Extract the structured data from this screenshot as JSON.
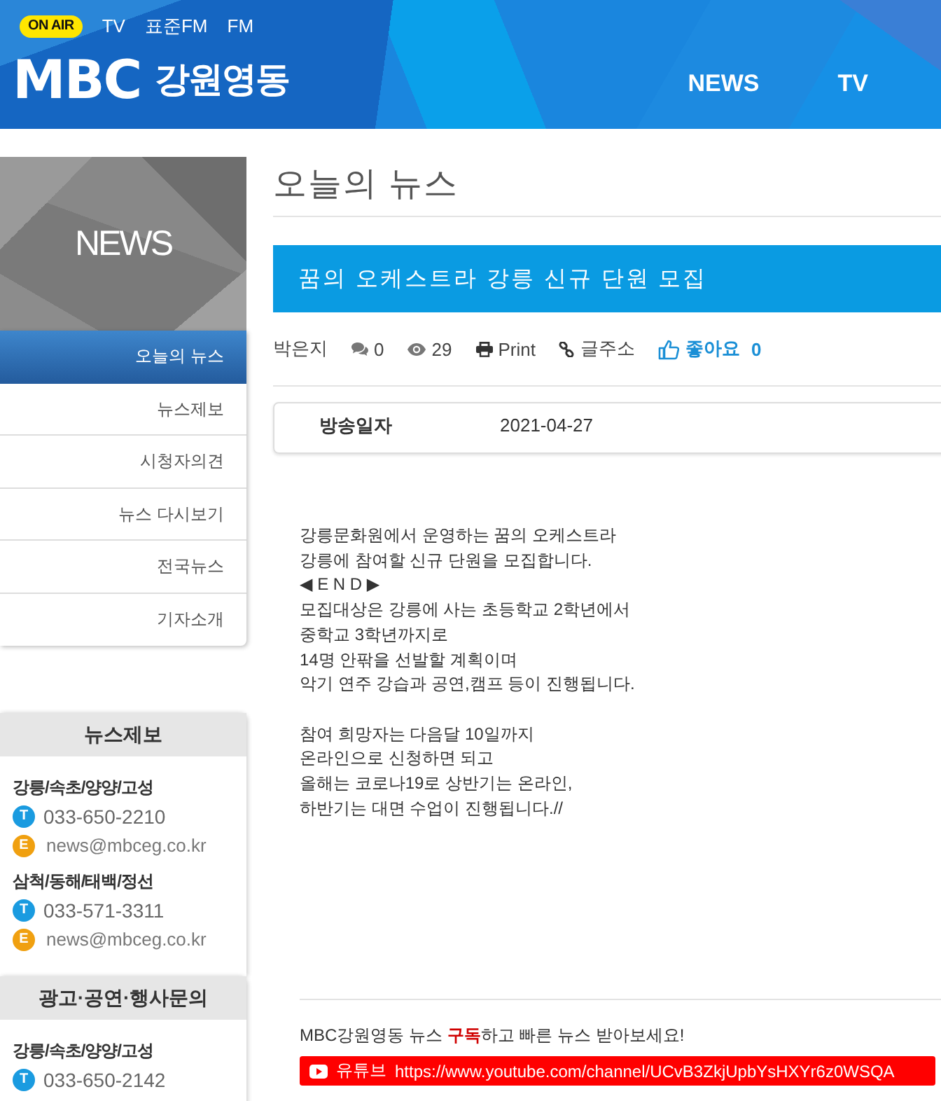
{
  "header": {
    "on_air": "ON AIR",
    "channels": [
      "TV",
      "표준FM",
      "FM"
    ],
    "logo": {
      "mark": "MBC",
      "region": "강원영동"
    },
    "nav": [
      "NEWS",
      "TV"
    ]
  },
  "sidebar": {
    "banner": "NEWS",
    "menu": [
      {
        "label": "오늘의 뉴스",
        "selected": true
      },
      {
        "label": "뉴스제보",
        "selected": false
      },
      {
        "label": "시청자의견",
        "selected": false
      },
      {
        "label": "뉴스 다시보기",
        "selected": false
      },
      {
        "label": "전국뉴스",
        "selected": false
      },
      {
        "label": "기자소개",
        "selected": false
      }
    ],
    "contacts": [
      {
        "title": "뉴스제보",
        "offices": [
          {
            "region": "강릉/속초/양양/고성",
            "phone_mark": "T",
            "phone": "033-650-2210",
            "email_mark": "E",
            "email": "news@mbceg.co.kr"
          },
          {
            "region": "삼척/동해/태백/정선",
            "phone_mark": "T",
            "phone": "033-571-3311",
            "email_mark": "E",
            "email": "news@mbceg.co.kr"
          }
        ]
      },
      {
        "title": "광고·공연·행사문의",
        "offices": [
          {
            "region": "강릉/속초/양양/고성",
            "phone_mark": "T",
            "phone": "033-650-2142"
          }
        ]
      }
    ]
  },
  "main": {
    "page_title": "오늘의 뉴스",
    "headline": "꿈의 오케스트라 강릉 신규 단원 모집",
    "meta": {
      "author": "박은지",
      "comments": "0",
      "views": "29",
      "print": "Print",
      "link": "글주소",
      "like": "좋아요",
      "likes": "0"
    },
    "broadcast": {
      "label": "방송일자",
      "date": "2021-04-27"
    },
    "body": [
      "강릉문화원에서 운영하는 꿈의 오케스트라\n강릉에 참여할 신규 단원을 모집합니다.\n◀ E N D ▶\n모집대상은 강릉에 사는 초등학교 2학년에서\n중학교 3학년까지로\n14명 안팎을 선발할 계획이며\n악기 연주 강습과 공연,캠프 등이 진행됩니다.",
      "참여 희망자는 다음달 10일까지\n온라인으로 신청하면 되고\n올해는 코로나19로 상반기는 온라인,\n하반기는 대면 수업이 진행됩니다.//"
    ],
    "subscribe": {
      "text": "MBC강원영동 뉴스 **구독**하고 빠른 뉴스 받아보세요!",
      "youtube_label": "유튜브",
      "youtube_url": "https://www.youtube.com/channel/UCvB3ZkjUpbYsHXYr6z0WSQA"
    }
  }
}
